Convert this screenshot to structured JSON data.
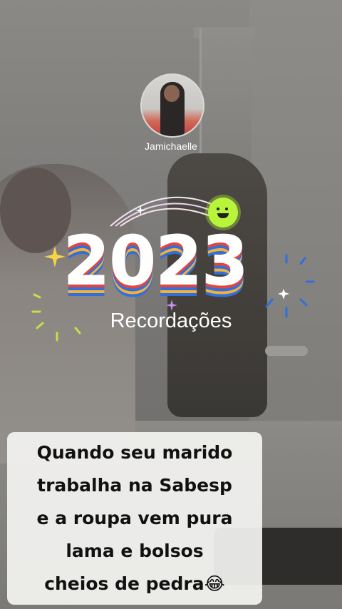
{
  "profile": {
    "username": "Jamichaelle",
    "avatar_icon": "profile-photo"
  },
  "recap": {
    "year": "2023",
    "title": "Recordações"
  },
  "caption": {
    "lines": [
      "Quando seu marido",
      "trabalha na Sabesp",
      "e a roupa vem pura",
      "lama e bolsos",
      "cheios de pedra😂"
    ]
  },
  "colors": {
    "layer_red": "#e2473d",
    "layer_blue": "#2f6fe0",
    "layer_yellow": "#f6b133",
    "sun_green": "#b8f53a",
    "caption_bg": "#f4f4f2"
  }
}
